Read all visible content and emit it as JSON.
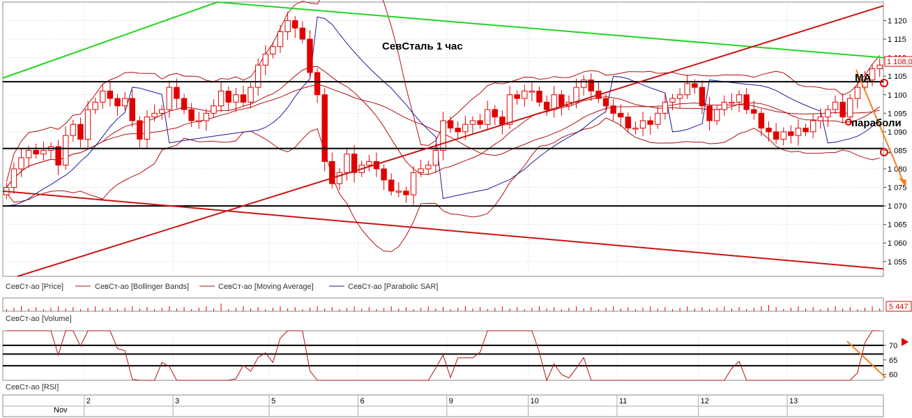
{
  "colors": {
    "bg": "#ffffff",
    "grid": "#c8c8c8",
    "candle": "#e00000",
    "bollinger": "#b01010",
    "ma": "#b01010",
    "sar": "#1a1a9a",
    "trend_green": "#22d422",
    "trend_red": "#c81414",
    "level": "#000000",
    "arrow": "#f08020",
    "marker": "#e00000"
  },
  "annotations": {
    "title": "СевСталь   1 час",
    "ma_note": "МА",
    "parabolic_note": "параболи"
  },
  "legend": {
    "price": "СевСт-ао [Price]",
    "bollinger": "СевСт-ао [Bollinger Bands]",
    "ma": "СевСт-ао [Moving Average]",
    "sar": "СевСт-ао [Parabolic SAR]",
    "volume": "СевСт-ао [Volume]",
    "rsi": "СевСт-ао [RSI]"
  },
  "badges": {
    "last_price": "1 108,0",
    "volume": "5 447"
  },
  "time_axis": {
    "month": "Nov"
  },
  "chart_data": [
    {
      "type": "candlestick",
      "title": "СевСталь   1 час",
      "ylim": [
        1051,
        1125
      ],
      "y_ticks": [
        "1 055",
        "1 060",
        "1 065",
        "1 070",
        "1 075",
        "1 080",
        "1 085",
        "1 090",
        "1 095",
        "1 100",
        "1 105",
        "1 110",
        "1 115",
        "1 120"
      ],
      "y_tick_values": [
        1055,
        1060,
        1065,
        1070,
        1075,
        1080,
        1085,
        1090,
        1095,
        1100,
        1105,
        1110,
        1115,
        1120
      ],
      "x_ticks": [
        "2",
        "3",
        "5",
        "6",
        "9",
        "10",
        "11",
        "12",
        "13"
      ],
      "x_tick_index": [
        11,
        23,
        36,
        48,
        60,
        71,
        83,
        94,
        106
      ],
      "bars": 119,
      "levels": [
        1103.5,
        1085.5,
        1070
      ],
      "close": [
        1075,
        1080,
        1083,
        1085,
        1084,
        1085,
        1086,
        1081,
        1089,
        1092,
        1088,
        1096,
        1098,
        1101,
        1099,
        1097,
        1099,
        1093,
        1088,
        1094,
        1095,
        1096,
        1102,
        1099,
        1096,
        1093,
        1093,
        1095,
        1097,
        1101,
        1098,
        1100,
        1098,
        1102,
        1108,
        1111,
        1113,
        1117,
        1120,
        1118,
        1115,
        1106,
        1100,
        1082,
        1076,
        1079,
        1084,
        1079,
        1081,
        1082,
        1080,
        1077,
        1074,
        1074,
        1073,
        1079,
        1080,
        1081,
        1085,
        1093,
        1091,
        1090,
        1092,
        1093,
        1092,
        1096,
        1094,
        1092,
        1100,
        1099,
        1101,
        1101,
        1098,
        1096,
        1100,
        1097,
        1098,
        1102,
        1104,
        1101,
        1099,
        1097,
        1095,
        1094,
        1091,
        1091,
        1093,
        1092,
        1095,
        1098,
        1099,
        1100,
        1103,
        1102,
        1097,
        1093,
        1096,
        1098,
        1098,
        1100,
        1096,
        1095,
        1091,
        1090,
        1088,
        1090,
        1089,
        1091,
        1090,
        1093,
        1094,
        1096,
        1098,
        1094,
        1099,
        1102,
        1104,
        1107,
        1108
      ],
      "volume_peak": 5447,
      "series": [
        {
          "name": "СевСт-ао [Price]",
          "kind": "candles"
        },
        {
          "name": "СевСт-ао [Bollinger Bands]",
          "kind": "band"
        },
        {
          "name": "СевСт-ао [Moving Average]",
          "kind": "line"
        },
        {
          "name": "СевСт-ао [Parabolic SAR]",
          "kind": "line"
        }
      ],
      "trendlines": [
        {
          "color": "green",
          "from": [
            0,
            1104.5
          ],
          "to": [
            29,
            1125
          ]
        },
        {
          "color": "green",
          "from": [
            29,
            1125
          ],
          "to": [
            119,
            1110
          ]
        },
        {
          "color": "red",
          "from": [
            2,
            1051
          ],
          "to": [
            119,
            1124
          ]
        },
        {
          "color": "red",
          "from": [
            0,
            1074
          ],
          "to": [
            119,
            1053
          ]
        }
      ]
    },
    {
      "type": "line",
      "title": "",
      "ylabel": "",
      "ylim": [
        58,
        75
      ],
      "y_ticks": [
        "60",
        "65",
        "70"
      ],
      "y_tick_values": [
        60,
        65,
        70
      ],
      "levels": [
        70,
        67,
        63
      ],
      "series": [
        {
          "name": "СевСт-ао [RSI]"
        }
      ]
    }
  ]
}
